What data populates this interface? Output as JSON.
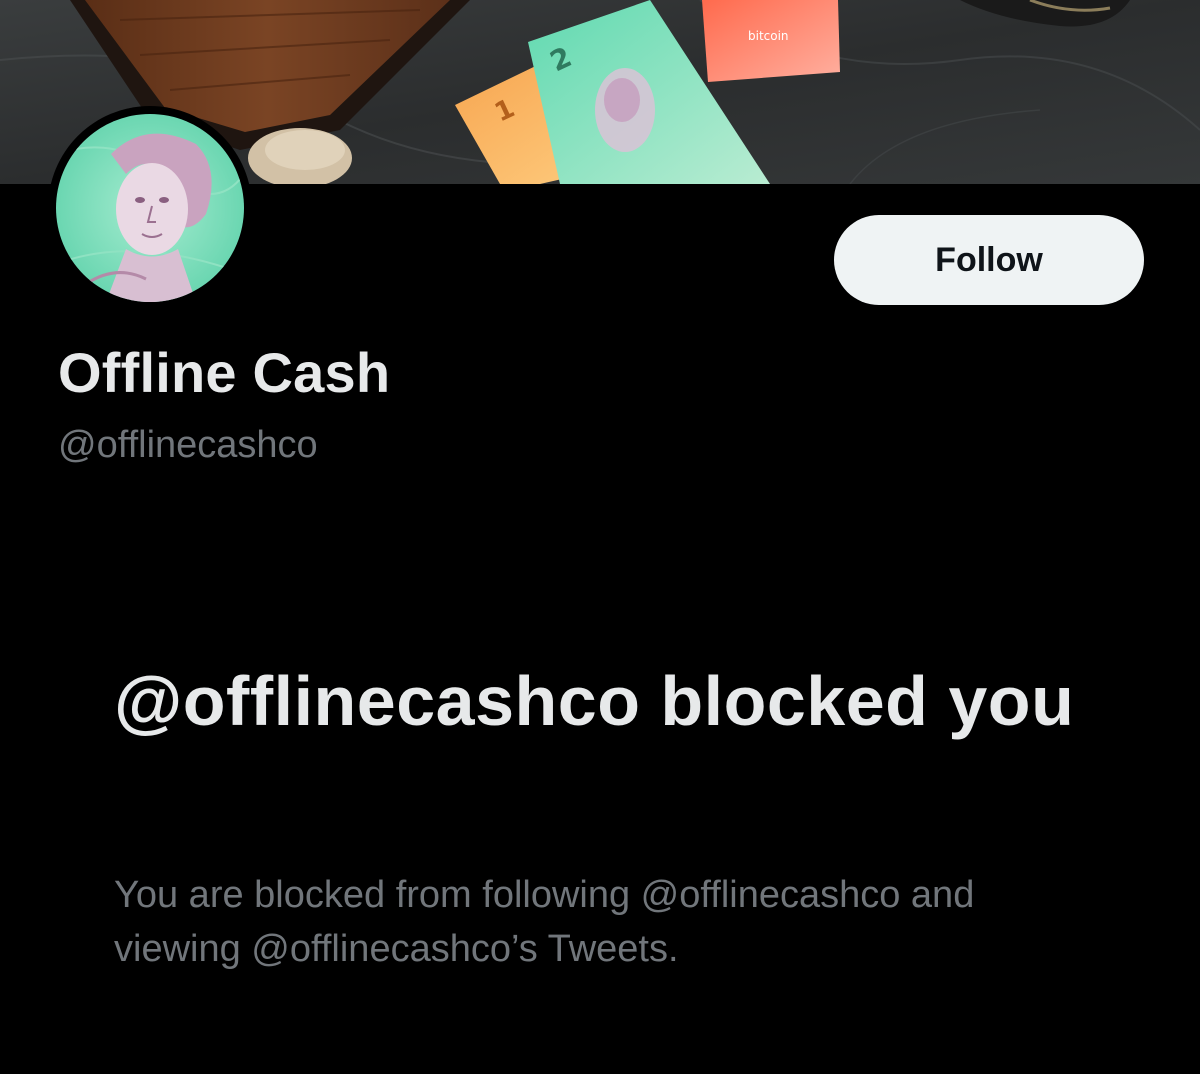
{
  "profile": {
    "display_name": "Offline Cash",
    "handle": "@offlinecashco",
    "follow_label": "Follow"
  },
  "blocked_notice": {
    "title": "@offlinecashco blocked you",
    "description": "You are blocked from following @offlinecashco and viewing @offlinecashco’s Tweets."
  },
  "banner": {
    "banknote_denominations": [
      "1",
      "2"
    ],
    "sticker_text": "bitcoin"
  },
  "colors": {
    "background": "#000000",
    "primary_text": "#e7e9ea",
    "secondary_text": "#71767b",
    "follow_button_bg": "#eff3f4",
    "follow_button_text": "#0f1419"
  }
}
